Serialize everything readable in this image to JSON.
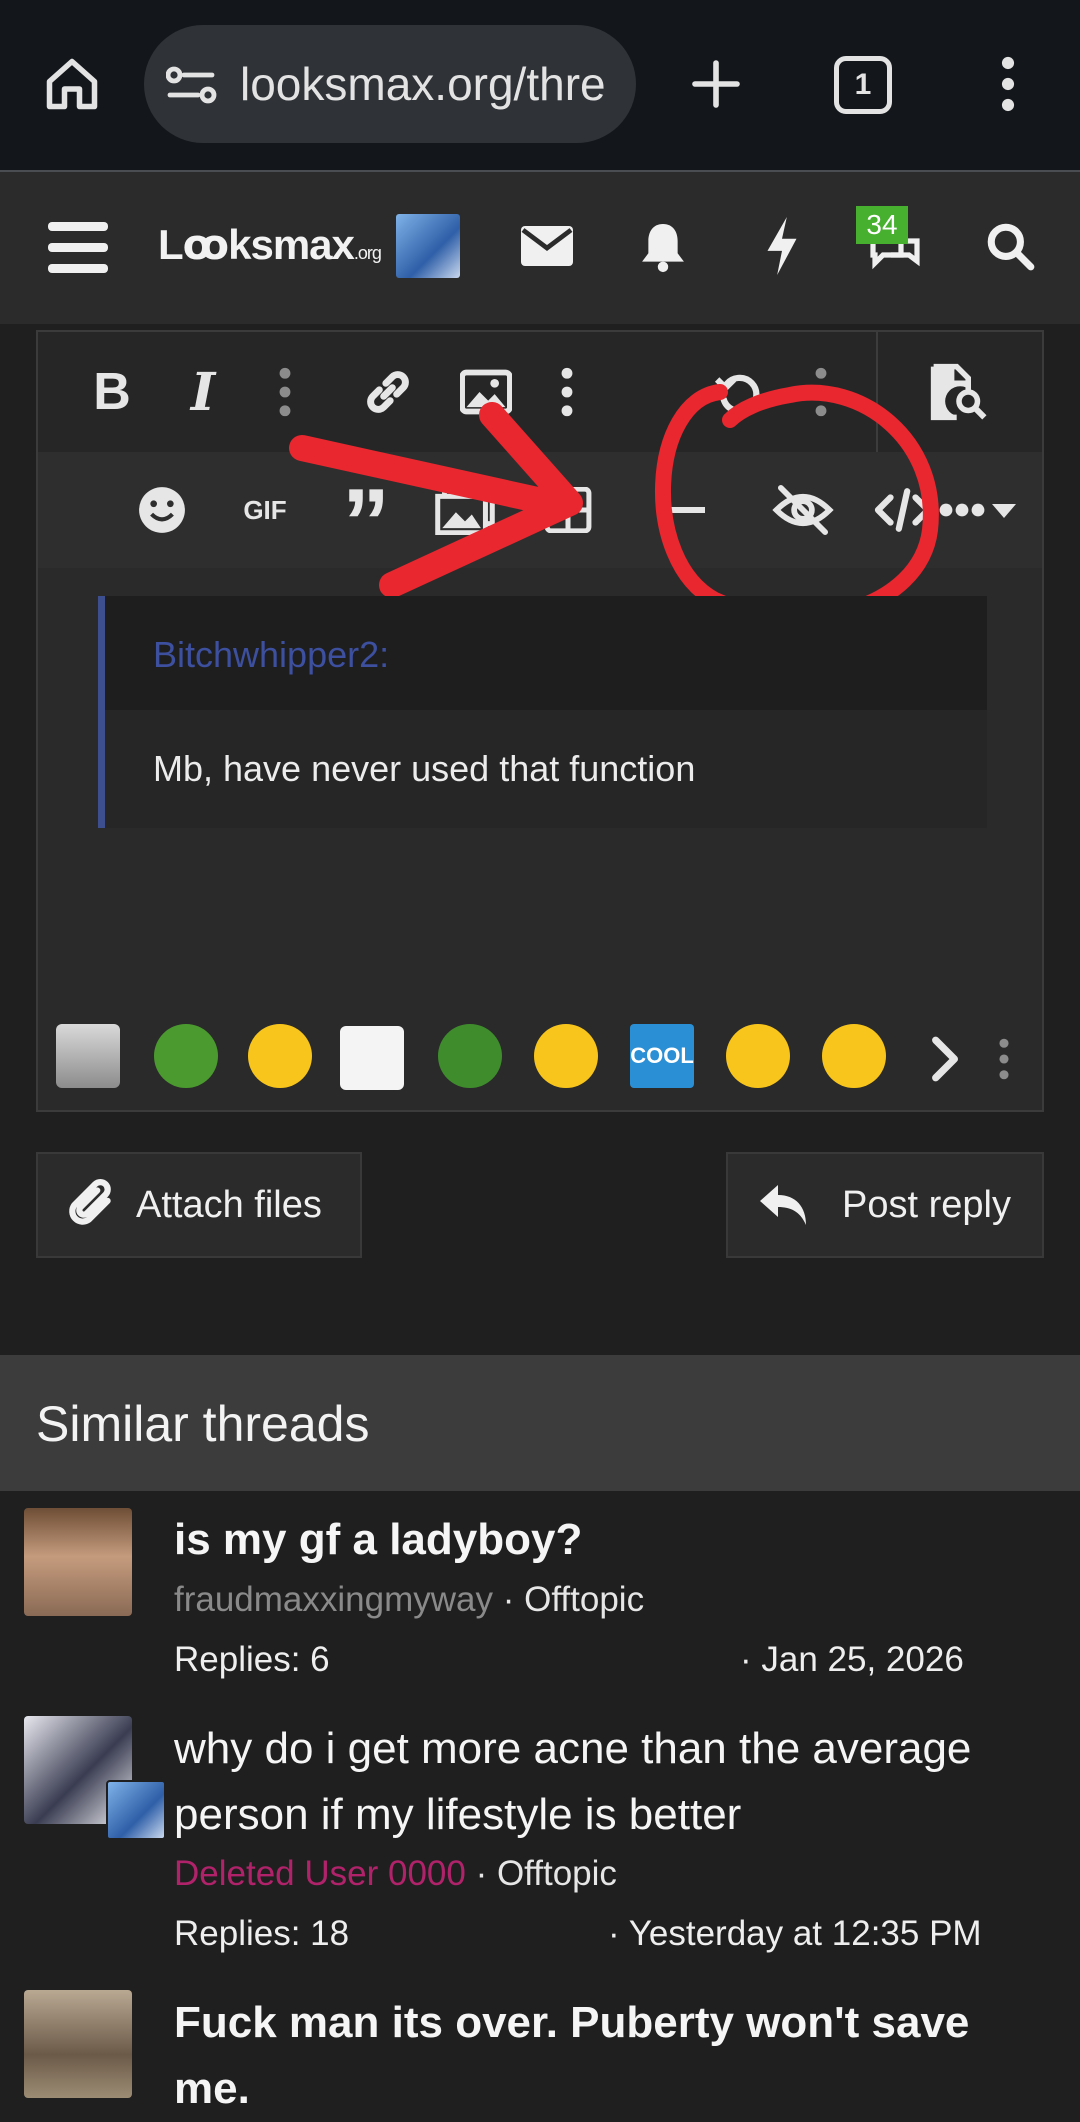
{
  "browser": {
    "url": "looksmax.org/thre",
    "tab_count": "1"
  },
  "site": {
    "logo_main": "Lꝏksmax",
    "logo_suffix": ".org",
    "chat_badge": "34"
  },
  "editor": {
    "toolbar_row1": [
      "bold-icon",
      "italic-icon",
      "more-vertical-icon",
      "link-icon",
      "image-icon",
      "more-vertical-icon",
      "undo-icon",
      "more-vertical-icon",
      "preview-icon"
    ],
    "toolbar_row2": [
      "smiley-icon",
      "gif-icon",
      "quote-icon",
      "media-icon",
      "table-icon",
      "hr-icon",
      "spoiler-hide-icon",
      "code-icon",
      "more-dropdown-icon"
    ],
    "gif_label": "GIF",
    "quote": {
      "author": "Bitchwhipper2:",
      "text": "Mb, have never used that function"
    },
    "emojis": [
      "trashcan-emoji",
      "pepe-tongue-emoji",
      "thinking-emoji",
      "troll-face-emoji",
      "pepe-sad-emoji",
      "eye-roll-emoji",
      "cool-emoji",
      "crying-laugh-emoji",
      "rofl-emoji"
    ],
    "cool_label": "COOL"
  },
  "actions": {
    "attach_label": "Attach files",
    "post_label": "Post reply"
  },
  "similar": {
    "heading": "Similar threads",
    "threads": [
      {
        "title": "is my gf a ladyboy?",
        "author": "fraudmaxxingmyway",
        "forum": "Offtopic",
        "replies": "Replies: 6",
        "date": "Jan 25, 2026"
      },
      {
        "title": "why do i get more acne than the average person if my lifestyle is better",
        "author": "Deleted User 0000",
        "forum": "Offtopic",
        "replies": "Replies: 18",
        "date": "Yesterday at 12:35 PM"
      },
      {
        "title": "Fuck man its over. Puberty won't save me."
      }
    ]
  },
  "annotation_color": "#e8272f"
}
